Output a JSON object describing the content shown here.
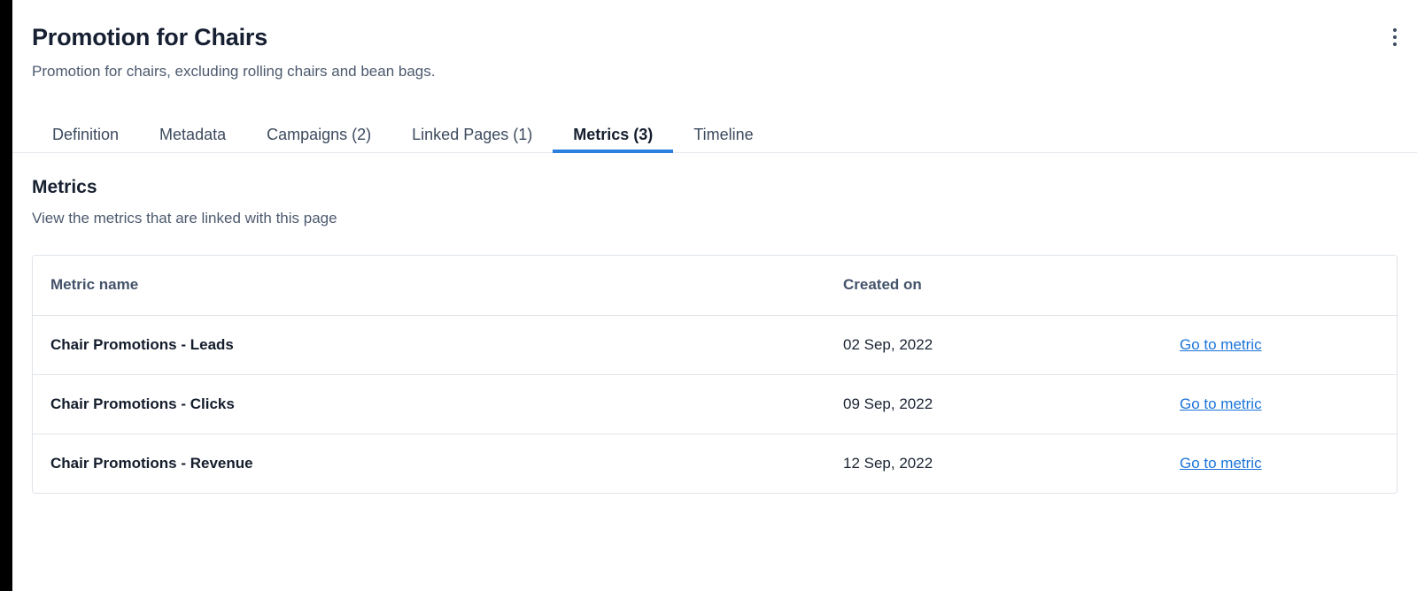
{
  "left_rail": {
    "color": "#000000"
  },
  "header": {
    "title": "Promotion for Chairs",
    "subtitle": "Promotion for chairs, excluding rolling chairs and bean bags.",
    "overflow_menu_icon": "kebab-menu-icon"
  },
  "tabs": {
    "active_index": 4,
    "accent_color": "#2b7fe0",
    "items": [
      {
        "label": "Definition"
      },
      {
        "label": "Metadata"
      },
      {
        "label": "Campaigns (2)"
      },
      {
        "label": "Linked Pages (1)"
      },
      {
        "label": "Metrics (3)"
      },
      {
        "label": "Timeline"
      }
    ]
  },
  "section": {
    "title": "Metrics",
    "description": "View the metrics that are linked with this page"
  },
  "table": {
    "columns": [
      "Metric name",
      "Created on",
      ""
    ],
    "link_label": "Go to metric",
    "link_color": "#1a73d8",
    "rows": [
      {
        "name": "Chair Promotions - Leads",
        "created_on": "02 Sep, 2022",
        "action": "Go to metric"
      },
      {
        "name": "Chair Promotions - Clicks",
        "created_on": "09 Sep, 2022",
        "action": "Go to metric"
      },
      {
        "name": "Chair Promotions - Revenue",
        "created_on": "12 Sep, 2022",
        "action": "Go to metric"
      }
    ]
  }
}
